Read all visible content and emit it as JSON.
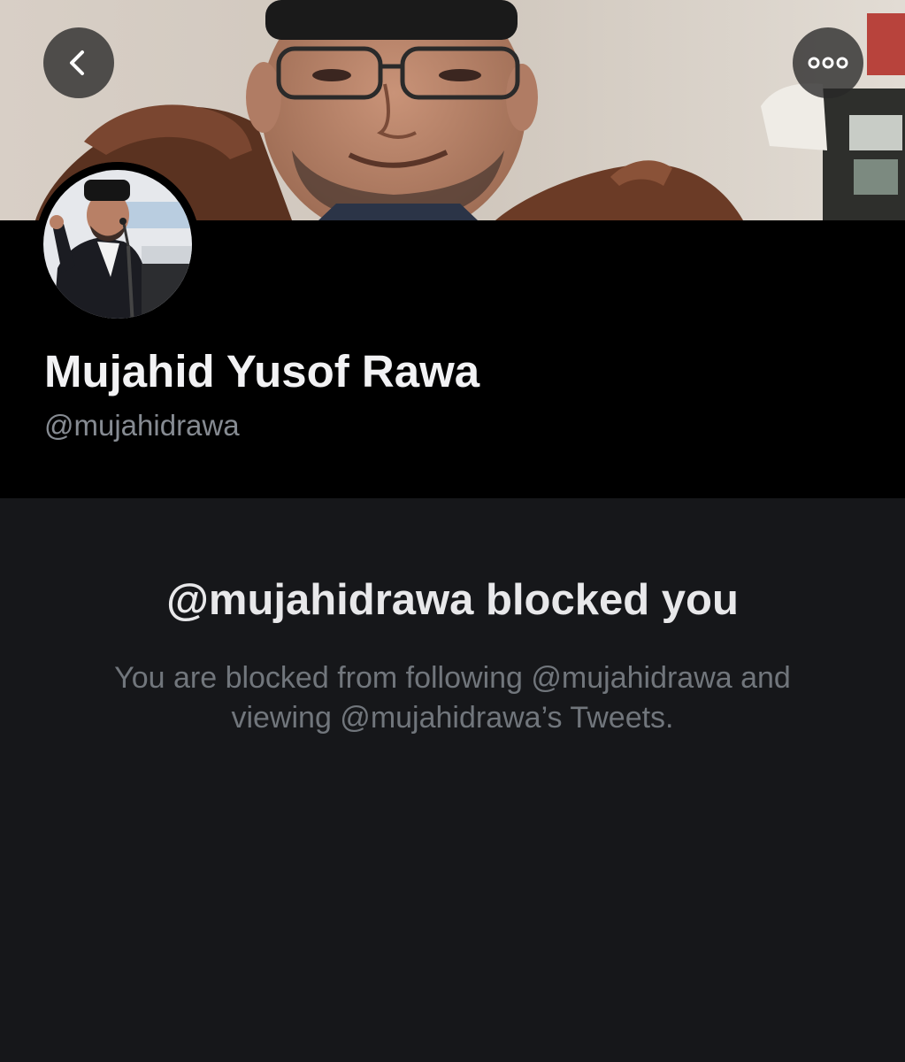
{
  "header": {
    "back_icon": "chevron-left-icon",
    "more_icon": "more-horizontal-icon"
  },
  "profile": {
    "display_name": "Mujahid Yusof Rawa",
    "handle": "@mujahidrawa"
  },
  "blocked": {
    "title": "@mujahidrawa blocked you",
    "line1": "You are blocked from following @mujahidrawa and",
    "line2": "viewing @mujahidrawa’s Tweets."
  },
  "colors": {
    "background": "#16171a",
    "header_background": "#000000",
    "primary_text": "#f2f2f4",
    "secondary_text": "#868b92"
  }
}
